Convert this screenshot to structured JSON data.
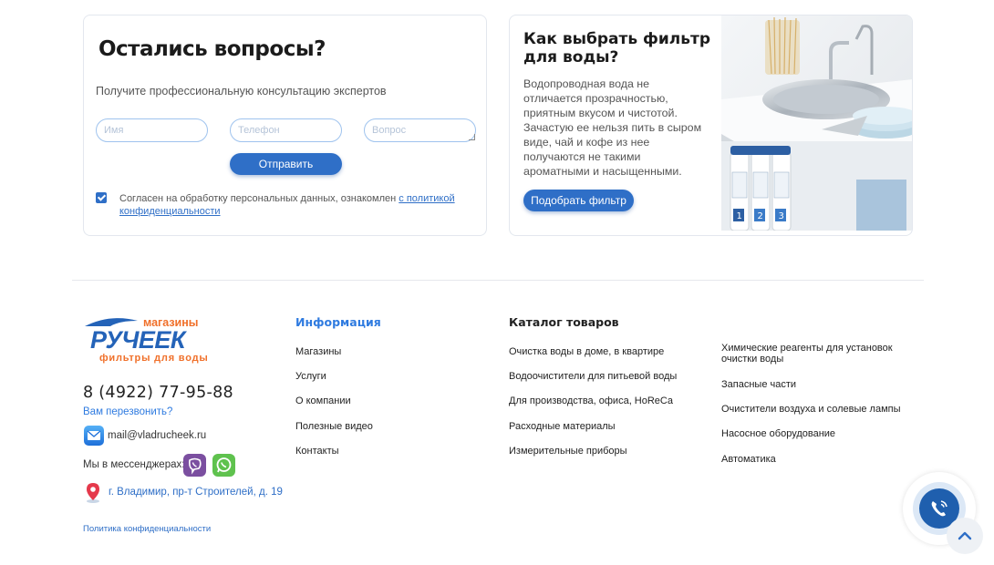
{
  "questions_form": {
    "title": "Остались вопросы?",
    "subtitle": "Получите профессиональную консультацию экспертов",
    "name_placeholder": "Имя",
    "phone_placeholder": "Телефон",
    "question_placeholder": "Вопрос",
    "submit_label": "Отправить",
    "consent_checked": true,
    "consent_text": "Согласен на обработку персональных данных, ознакомлен ",
    "consent_link": "с политикой конфиденциальности"
  },
  "filter_promo": {
    "title": "Как выбрать фильтр для воды?",
    "text": "Водопроводная вода не отличается прозрачностью, приятным вкусом и чистотой. Зачастую ее нельзя пить в сыром виде, чай и кофе из нее получаются не такими ароматными и насыщенными.",
    "button_label": "Подобрать фильтр",
    "filter_numbers": [
      "1",
      "2",
      "3"
    ]
  },
  "footer": {
    "logo": {
      "top_text": "магазины",
      "main_text": "РУЧЕЕК",
      "bottom_text": "фильтры для воды"
    },
    "phone": "8 (4922) 77-95-88",
    "callback_label": "Вам перезвонить?",
    "email": "mail@vladrucheek.ru",
    "messengers_label": "Мы в мессенджерах:",
    "address": "г. Владимир, пр-т Строителей, д. 19",
    "policy_link": "Политика конфиденциальности",
    "info": {
      "title": "Информация",
      "items": [
        "Магазины",
        "Услуги",
        "О компании",
        "Полезные видео",
        "Контакты"
      ]
    },
    "catalog": {
      "title": "Каталог товаров",
      "items": [
        "Очистка воды в доме, в квартире",
        "Водоочистители для питьевой воды",
        "Для производства, офиса, HoReCa",
        "Расходные материалы",
        "Измерительные приборы"
      ],
      "items_col2": [
        "Химические реагенты для установок очистки воды",
        "Запасные части",
        "Очистители воздуха и солевые лампы",
        "Насосное оборудование",
        "Автоматика"
      ]
    }
  },
  "icons": {
    "mail": "mail-icon",
    "viber": "viber-icon",
    "whatsapp": "whatsapp-icon",
    "location": "location-pin-icon",
    "call": "phone-call-icon",
    "scroll_up": "chevron-up-icon"
  },
  "colors": {
    "accent_blue": "#2f6fc7",
    "link_blue": "#2f7be0",
    "logo_orange": "#f0702a",
    "logo_blue": "#2463b8"
  }
}
